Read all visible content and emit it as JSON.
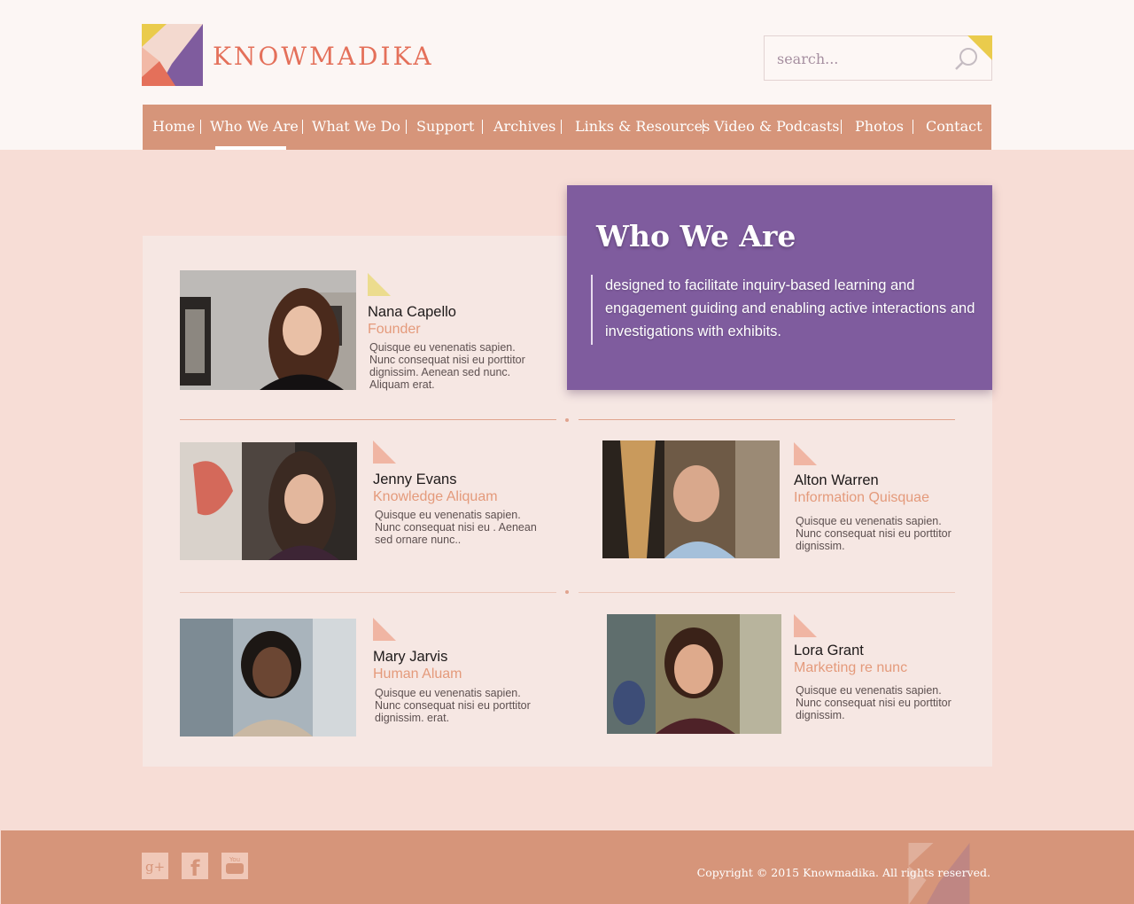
{
  "brand": {
    "name": "KNOWMADIKA"
  },
  "search": {
    "placeholder": "search..."
  },
  "nav": {
    "items": [
      {
        "label": "Home"
      },
      {
        "label": "Who We Are"
      },
      {
        "label": "What We Do"
      },
      {
        "label": "Support"
      },
      {
        "label": "Archives"
      },
      {
        "label": "Links & Resources"
      },
      {
        "label": "Video & Podcasts"
      },
      {
        "label": "Photos"
      },
      {
        "label": "Contact"
      }
    ],
    "active": "Who We Are"
  },
  "intro": {
    "title": "Who We Are",
    "text": "designed to facilitate inquiry-based learning and engagement  guiding and enabling active interactions and investigations with exhibits."
  },
  "team": [
    {
      "name": "Nana Capello",
      "role": "Founder",
      "bio": "Quisque eu venenatis sapien. Nunc consequat nisi eu porttitor dignissim. Aenean sed nunc. Aliquam erat."
    },
    {
      "name": "Jenny Evans",
      "role": "Knowledge Aliquam",
      "bio": "Quisque eu venenatis sapien. Nunc consequat nisi eu . Aenean sed ornare nunc.."
    },
    {
      "name": "Alton Warren",
      "role": "Information Quisquae",
      "bio": "Quisque eu venenatis sapien. Nunc consequat nisi eu porttitor dignissim."
    },
    {
      "name": "Mary Jarvis",
      "role": "Human Aluam",
      "bio": "Quisque eu venenatis sapien. Nunc consequat nisi eu porttitor dignissim. erat."
    },
    {
      "name": "Lora Grant",
      "role": "Marketing re nunc",
      "bio": "Quisque eu venenatis sapien. Nunc consequat nisi eu porttitor dignissim."
    }
  ],
  "footer": {
    "social": [
      {
        "icon": "google-plus-icon"
      },
      {
        "icon": "facebook-icon"
      },
      {
        "icon": "youtube-icon"
      }
    ],
    "copyright": "Copyright © 2015 Knowmadika. All rights reserved."
  },
  "colors": {
    "accent": "#e4705a",
    "nav": "#d6957a",
    "purple": "#7f5c9e",
    "yellow": "#eacb4c",
    "page": "#f7ddd6"
  }
}
